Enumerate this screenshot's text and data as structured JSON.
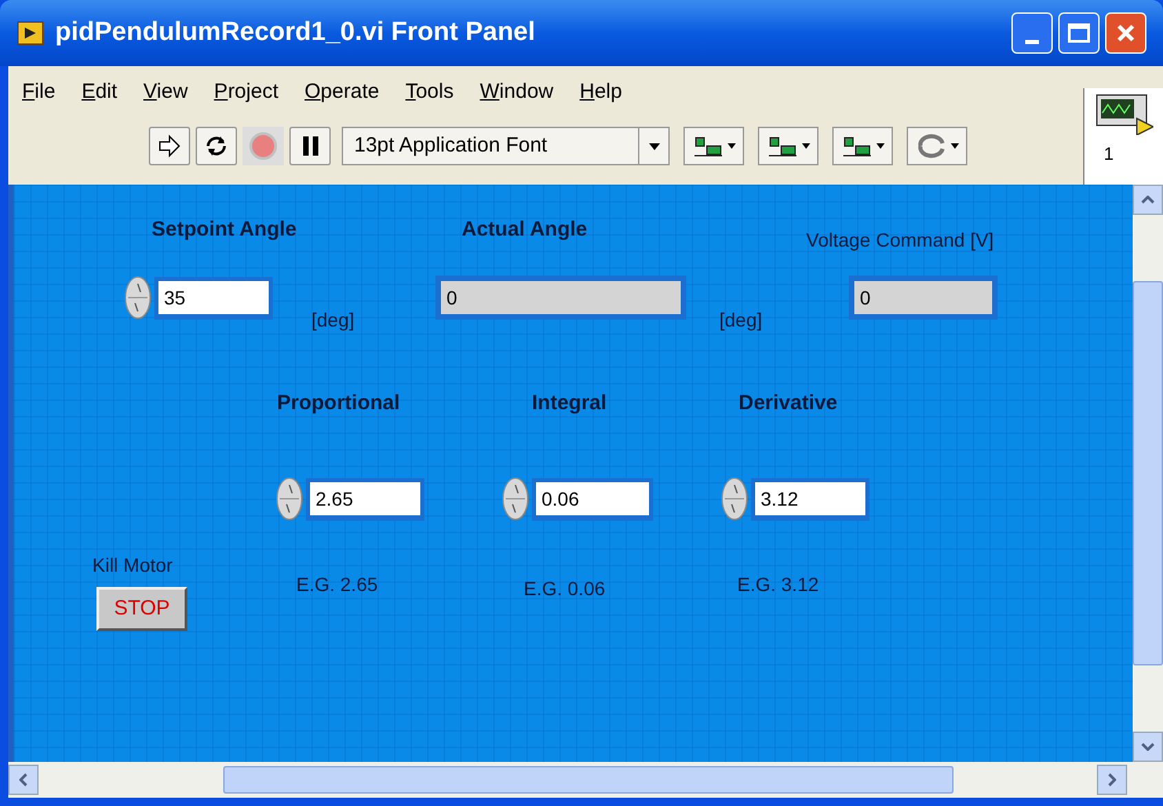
{
  "window": {
    "title": "pidPendulumRecord1_0.vi Front Panel"
  },
  "menu": [
    {
      "label": "File"
    },
    {
      "label": "Edit"
    },
    {
      "label": "View"
    },
    {
      "label": "Project"
    },
    {
      "label": "Operate"
    },
    {
      "label": "Tools"
    },
    {
      "label": "Window"
    },
    {
      "label": "Help"
    }
  ],
  "toolbar": {
    "font": "13pt Application Font",
    "vi_icon_label": "1"
  },
  "panel": {
    "items": [
      {
        "kind": "title",
        "text": "Setpoint Angle"
      },
      {
        "kind": "control",
        "value": "35"
      },
      {
        "kind": "label",
        "text": "[deg]"
      },
      {
        "kind": "title",
        "text": "Actual Angle"
      },
      {
        "kind": "indicator",
        "value": "0"
      },
      {
        "kind": "label",
        "text": "[deg]"
      },
      {
        "kind": "label",
        "text": "Voltage Command [V]"
      },
      {
        "kind": "indicator",
        "value": "0"
      },
      {
        "kind": "title",
        "text": "Proportional"
      },
      {
        "kind": "title",
        "text": "Integral"
      },
      {
        "kind": "title",
        "text": "Derivative"
      },
      {
        "kind": "control",
        "value": "2.65"
      },
      {
        "kind": "control",
        "value": "0.06"
      },
      {
        "kind": "control",
        "value": "3.12"
      },
      {
        "kind": "label",
        "text": "Kill Motor"
      },
      {
        "kind": "stop",
        "text": "STOP"
      },
      {
        "kind": "label",
        "text": "E.G. 2.65"
      },
      {
        "kind": "label",
        "text": "E.G. 0.06"
      },
      {
        "kind": "label",
        "text": "E.G. 3.12"
      }
    ]
  }
}
